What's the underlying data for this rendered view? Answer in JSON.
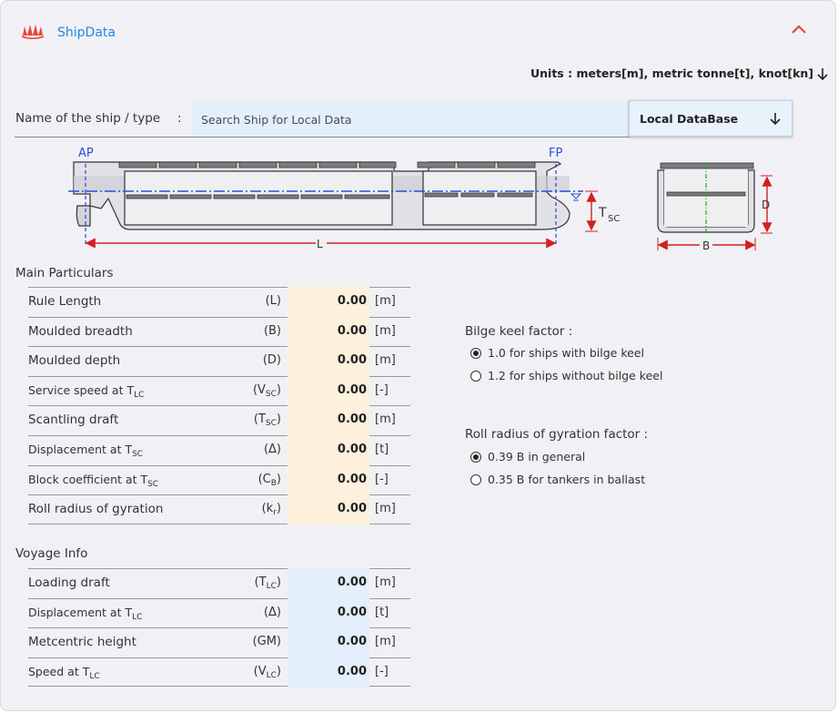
{
  "header": {
    "title": "ShipData",
    "logo_icon": "ship-logo-icon",
    "collapse_icon": "chevron-up-icon",
    "accent_color": "#e8453c",
    "title_color": "#1e88e5"
  },
  "units": {
    "label": "Units : meters[m], metric tonne[t], knot[kn]"
  },
  "ship_name": {
    "label": "Name of the ship / type",
    "colon": ":",
    "placeholder": "Search Ship for Local Data",
    "value": "",
    "database": "Local DataBase"
  },
  "diagram": {
    "ap": "AP",
    "fp": "FP",
    "length": "L",
    "draft": "T",
    "draft_sub": "SC",
    "depth": "D",
    "breadth": "B"
  },
  "main_particulars": {
    "title": "Main Particulars",
    "rows": [
      {
        "label": "Rule Length",
        "label_sub": "",
        "sym": "(L)",
        "sym_sub": "",
        "sym_tail": "",
        "value": "0.00",
        "unit": "[m]"
      },
      {
        "label": "Moulded breadth",
        "label_sub": "",
        "sym": "(B)",
        "sym_sub": "",
        "sym_tail": "",
        "value": "0.00",
        "unit": "[m]"
      },
      {
        "label": "Moulded depth",
        "label_sub": "",
        "sym": "(D)",
        "sym_sub": "",
        "sym_tail": "",
        "value": "0.00",
        "unit": "[m]"
      },
      {
        "label": "Service speed at T",
        "label_sub": "LC",
        "sym": "(V",
        "sym_sub": "SC",
        "sym_tail": ")",
        "value": "0.00",
        "unit": "[-]"
      },
      {
        "label": "Scantling draft",
        "label_sub": "",
        "sym": "(T",
        "sym_sub": "SC",
        "sym_tail": ")",
        "value": "0.00",
        "unit": "[m]"
      },
      {
        "label": "Displacement at T",
        "label_sub": "SC",
        "sym": "(Δ)",
        "sym_sub": "",
        "sym_tail": "",
        "value": "0.00",
        "unit": "[t]"
      },
      {
        "label": "Block coefficient at T",
        "label_sub": "SC",
        "sym": "(C",
        "sym_sub": "B",
        "sym_tail": ")",
        "value": "0.00",
        "unit": "[-]"
      },
      {
        "label": "Roll radius of gyration",
        "label_sub": "",
        "sym": "(k",
        "sym_sub": "r",
        "sym_tail": ")",
        "value": "0.00",
        "unit": "[m]"
      }
    ]
  },
  "voyage_info": {
    "title": "Voyage Info",
    "rows": [
      {
        "label": "Loading draft",
        "label_sub": "",
        "sym": "(T",
        "sym_sub": "LC",
        "sym_tail": ")",
        "value": "0.00",
        "unit": "[m]"
      },
      {
        "label": "Displacement at T",
        "label_sub": "LC",
        "sym": "(Δ)",
        "sym_sub": "",
        "sym_tail": "",
        "value": "0.00",
        "unit": "[t]"
      },
      {
        "label": "Metcentric height",
        "label_sub": "",
        "sym": "(GM)",
        "sym_sub": "",
        "sym_tail": "",
        "value": "0.00",
        "unit": "[m]"
      },
      {
        "label": "Speed at T",
        "label_sub": "LC",
        "sym": "(V",
        "sym_sub": "LC",
        "sym_tail": ")",
        "value": "0.00",
        "unit": "[-]"
      }
    ]
  },
  "bilge_keel": {
    "title": "Bilge keel factor :",
    "options": [
      {
        "label": "1.0 for ships with bilge keel",
        "selected": true
      },
      {
        "label": "1.2 for ships without bilge keel",
        "selected": false
      }
    ]
  },
  "roll_radius": {
    "title": "Roll radius of gyration factor :",
    "options": [
      {
        "label": "0.39 B in general",
        "selected": true
      },
      {
        "label": "0.35 B for tankers in ballast",
        "selected": false
      }
    ]
  }
}
